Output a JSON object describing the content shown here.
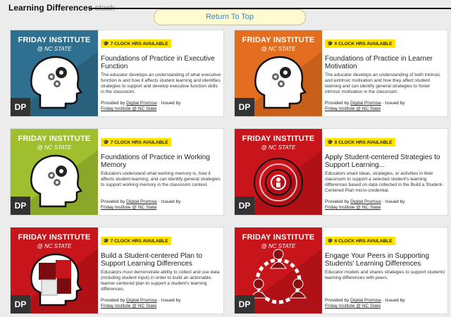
{
  "header": {
    "title_bold": "Learning Differences",
    "title_light": "stack",
    "return_to_top": "Return To Top"
  },
  "thumbnail": {
    "brand": "FRIDAY INSTITUTE",
    "brand_sub": "@ NC STATE",
    "logo": "DP"
  },
  "provider": {
    "provided_by": "Provided by",
    "provider_link": "Digital Promise",
    "issued_by": "· Issued by",
    "issuer_link": "Friday Institute @ NC State"
  },
  "cards": [
    {
      "hours": "7 CLOCK HRS AVAILABLE",
      "title": "Foundations of Practice in Executive Function",
      "desc": "The educator develops an understanding of what executive function is and how it affects student learning and identifies strategies to support and develop executive function skills in the classroom.",
      "color": "#2f6f8f",
      "icon": "head-gears-icon"
    },
    {
      "hours": "6 CLOCK HRS AVAILABLE",
      "title": "Foundations of Practice in Learner Motivation",
      "desc": "The educator develops an understanding of both intrinsic and extrinsic motivation and how they affect student learning and can identify general strategies to foster intrinsic motivation in the classroom.",
      "color": "#e46e1f",
      "icon": "head-gears-icon"
    },
    {
      "hours": "7 CLOCK HRS AVAILABLE",
      "title": "Foundations of Practice in Working Memory",
      "desc": "Educators understand what working memory is, how it affects student learning, and can identify general strategies to support working memory in the classroom context.",
      "color": "#9fbf2f",
      "icon": "head-gears-icon"
    },
    {
      "hours": "8 CLOCK HRS AVAILABLE",
      "title": "Apply Student-centered Strategies to Support Learning...",
      "desc": "Educators enact ideas, strategies, or activities in their classroom to support a selected student's learning differences based on data collected in the Build a Student-Centered Plan micro-credential.",
      "color": "#c8141b",
      "icon": "maze-person-icon"
    },
    {
      "hours": "7 CLOCK HRS AVAILABLE",
      "title": "Build a Student-centered Plan to Support Learning Differences",
      "desc": "Educators must demonstrate ability to collect and use data (including student input) in order to build an actionable, learner-centered plan to support a student's learning differences.",
      "color": "#c8141b",
      "icon": "head-puzzle-icon"
    },
    {
      "hours": "6 CLOCK HRS AVAILABLE",
      "title": "Engage Your Peers in Supporting Students' Learning Differences",
      "desc": "Educator models and shares strategies to support students' learning differences with peers.",
      "color": "#c8141b",
      "icon": "people-circle-icon"
    }
  ]
}
